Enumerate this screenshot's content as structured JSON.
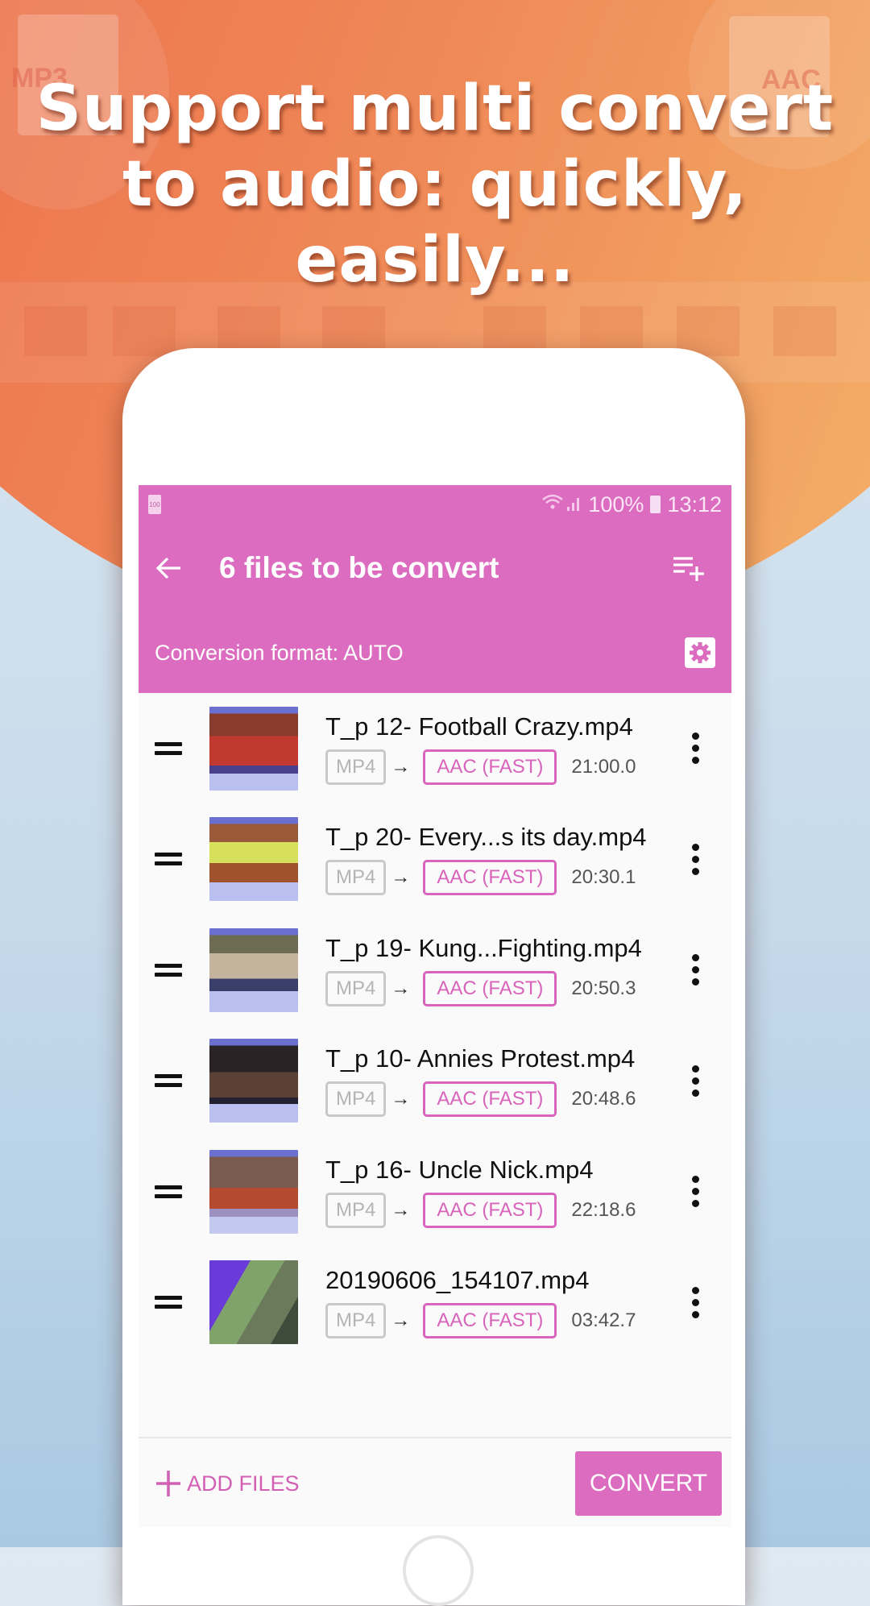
{
  "promo": {
    "headline_line1": "Support multi convert",
    "headline_line2": "to audio: quickly, easily...",
    "deco_left_label": "MP3",
    "deco_right_label": "AAC"
  },
  "status_bar": {
    "battery_badge": "100",
    "battery_percent": "100%",
    "time": "13:12"
  },
  "toolbar": {
    "title": "6 files to be convert",
    "back_icon": "arrow-left-icon",
    "add_to_queue_icon": "playlist-add-icon"
  },
  "format_row": {
    "label": "Conversion format:  AUTO",
    "settings_icon": "gear-icon"
  },
  "files": [
    {
      "name": "T_p 12- Football Crazy.mp4",
      "source_format": "MP4",
      "target_format": "AAC (FAST)",
      "duration": "21:00.0"
    },
    {
      "name": "T_p 20- Every...s its day.mp4",
      "source_format": "MP4",
      "target_format": "AAC (FAST)",
      "duration": "20:30.1"
    },
    {
      "name": "T_p 19- Kung...Fighting.mp4",
      "source_format": "MP4",
      "target_format": "AAC (FAST)",
      "duration": "20:50.3"
    },
    {
      "name": "T_p 10- Annies Protest.mp4",
      "source_format": "MP4",
      "target_format": "AAC (FAST)",
      "duration": "20:48.6"
    },
    {
      "name": "T_p 16- Uncle Nick.mp4",
      "source_format": "MP4",
      "target_format": "AAC (FAST)",
      "duration": "22:18.6"
    },
    {
      "name": "20190606_154107.mp4",
      "source_format": "MP4",
      "target_format": "AAC (FAST)",
      "duration": "03:42.7"
    }
  ],
  "arrow_glyph": "→",
  "footer": {
    "add_files_label": "ADD FILES",
    "convert_label": "CONVERT"
  },
  "colors": {
    "accent": "#db6cbf",
    "hero_start": "#ec6549",
    "hero_end": "#f5bb6c"
  }
}
